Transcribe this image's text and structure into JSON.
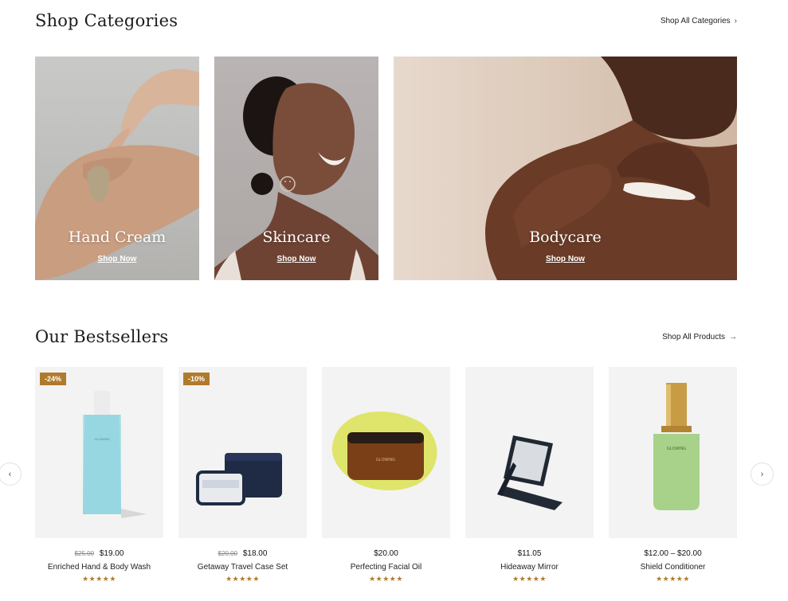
{
  "categories_section": {
    "title": "Shop Categories",
    "link_label": "Shop All Categories",
    "items": [
      {
        "label": "Hand Cream",
        "link": "Shop Now"
      },
      {
        "label": "Skincare",
        "link": "Shop Now"
      },
      {
        "label": "Bodycare",
        "link": "Shop Now"
      }
    ]
  },
  "bestsellers_section": {
    "title": "Our Bestsellers",
    "link_label": "Shop All Products",
    "products": [
      {
        "name": "Enriched Hand & Body Wash",
        "old_price": "$25.00",
        "price": "$19.00",
        "badge": "-24%",
        "rating": 5,
        "stars": "★★★★★",
        "brand": "GLOWING"
      },
      {
        "name": "Getaway Travel Case Set",
        "old_price": "$20.00",
        "price": "$18.00",
        "badge": "-10%",
        "rating": 5,
        "stars": "★★★★★"
      },
      {
        "name": "Perfecting Facial Oil",
        "old_price": "",
        "price": "$20.00",
        "badge": "",
        "rating": 5,
        "stars": "★★★★★",
        "brand": "GLOWING"
      },
      {
        "name": "Hideaway Mirror",
        "old_price": "",
        "price": "$11.05",
        "badge": "",
        "rating": 5,
        "stars": "★★★★★"
      },
      {
        "name": "Shield Conditioner",
        "old_price": "",
        "price": "$12.00 – $20.00",
        "badge": "",
        "rating": 5,
        "stars": "★★★★★",
        "brand": "GLOWING"
      }
    ]
  },
  "icons": {
    "link_arrow": "›",
    "link_arrow_right": "→",
    "prev": "‹",
    "next": "›"
  },
  "colors": {
    "badge": "#b07a2c",
    "stars": "#b07a2c",
    "product_bg": "#f3f3f3"
  }
}
